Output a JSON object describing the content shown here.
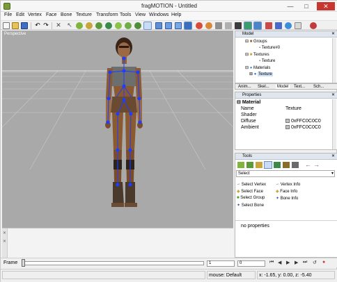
{
  "window": {
    "title": "fragMOTION - Untitled"
  },
  "menu": [
    "File",
    "Edit",
    "Vertex",
    "Face",
    "Bone",
    "Texture",
    "Transform",
    "Tools",
    "View",
    "Windows",
    "Help"
  ],
  "viewport": {
    "label": "Perspective"
  },
  "model_panel": {
    "title": "Model",
    "tree": [
      "Groups",
      "Texture#0",
      "Textures",
      "Texture",
      "Materials",
      "Texture"
    ],
    "tabs": [
      "Anim...",
      "Skel...",
      "Model",
      "Text...",
      "Sch..."
    ]
  },
  "properties_panel": {
    "title": "Properties",
    "section": "Material",
    "rows": [
      {
        "key": "Name",
        "value": "Texture"
      },
      {
        "key": "Shader",
        "value": ""
      },
      {
        "key": "Diffuse",
        "value": "0xFFC0C0C0"
      },
      {
        "key": "Ambient",
        "value": "0xFFC0C0C0"
      }
    ]
  },
  "tools_panel": {
    "title": "Tools",
    "select_value": "Select",
    "left_tools": [
      "Select Vertex",
      "Select Face",
      "Select Group",
      "Select Bone"
    ],
    "right_tools": [
      "Vertex Info",
      "Face Info",
      "Bone Info"
    ],
    "info_text": "no properties"
  },
  "timeline": {
    "label": "Frame",
    "frame_value": "1",
    "end_value": "0"
  },
  "statusbar": {
    "mode": "mouse: Default",
    "coords": "x: -1.65, y: 0.00, z: -5.40"
  },
  "colors": {
    "viewport_bg": "#a9a9a9",
    "panel_header": "#dfe6ee",
    "bone": "#1f3cff",
    "close": "#c7372f"
  }
}
